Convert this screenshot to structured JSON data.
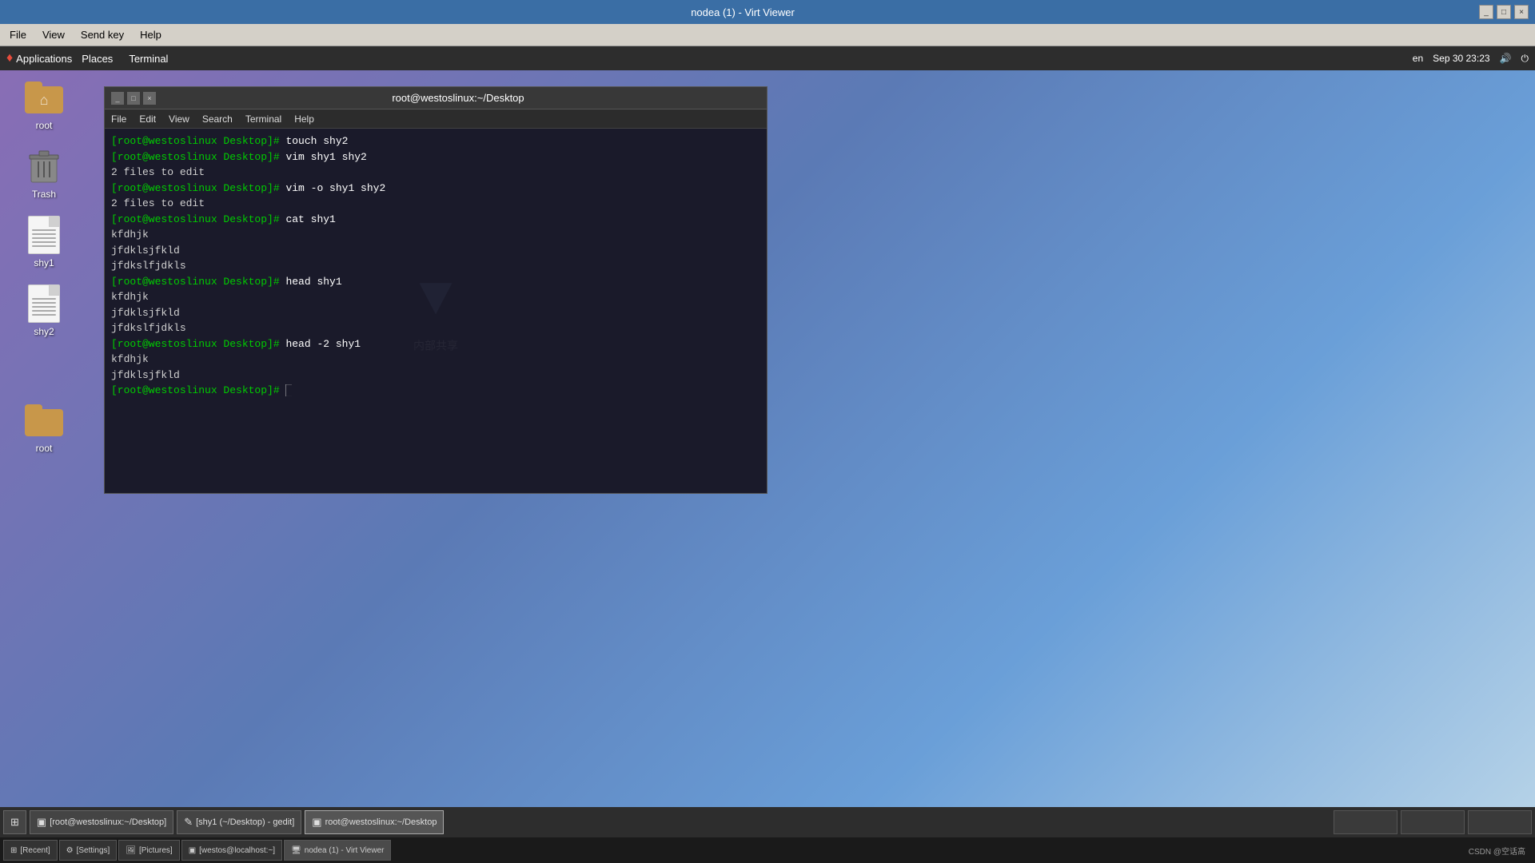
{
  "virtviewer": {
    "title": "nodea (1) - Virt Viewer",
    "menu": {
      "file": "File",
      "view": "View",
      "sendkey": "Send key",
      "help": "Help"
    },
    "titlebar_buttons": {
      "minimize": "_",
      "maximize": "□",
      "close": "×"
    }
  },
  "vm": {
    "panel": {
      "apps_label": "Applications",
      "places_label": "Places",
      "terminal_label": "Terminal",
      "locale": "en",
      "datetime": "Sep 30  23:23"
    },
    "desktop_icons": [
      {
        "id": "root-folder-top",
        "label": "root",
        "type": "folder-home"
      },
      {
        "id": "trash",
        "label": "Trash",
        "type": "trash"
      },
      {
        "id": "shy1-file",
        "label": "shy1",
        "type": "file"
      },
      {
        "id": "shy2-file",
        "label": "shy2",
        "type": "file"
      },
      {
        "id": "root-folder-bottom",
        "label": "root",
        "type": "folder"
      }
    ],
    "terminal": {
      "title": "root@westoslinux:~/Desktop",
      "menu": [
        "File",
        "Edit",
        "View",
        "Search",
        "Terminal",
        "Help"
      ],
      "lines": [
        {
          "type": "prompt",
          "text": "[root@westoslinux Desktop]# touch shy2"
        },
        {
          "type": "prompt",
          "text": "[root@westoslinux Desktop]# vim shy1 shy2"
        },
        {
          "type": "output",
          "text": "2 files to edit"
        },
        {
          "type": "prompt",
          "text": "[root@westoslinux Desktop]# vim -o shy1 shy2"
        },
        {
          "type": "output",
          "text": "2 files to edit"
        },
        {
          "type": "prompt",
          "text": "[root@westoslinux Desktop]# cat shy1"
        },
        {
          "type": "output",
          "text": "kfdhjk"
        },
        {
          "type": "output",
          "text": "jfdklsjfkld"
        },
        {
          "type": "output",
          "text": "jfdkslfjdkls"
        },
        {
          "type": "prompt",
          "text": "[root@westoslinux Desktop]# head shy1"
        },
        {
          "type": "output",
          "text": "kfdhjk"
        },
        {
          "type": "output",
          "text": "jfdklsjfkld"
        },
        {
          "type": "output",
          "text": "jfdkslfjdkls"
        },
        {
          "type": "prompt",
          "text": "[root@westoslinux Desktop]# head -2 shy1"
        },
        {
          "type": "output",
          "text": "kfdhjk"
        },
        {
          "type": "output",
          "text": "jfdklsjfkld"
        },
        {
          "type": "prompt-empty",
          "text": "[root@westoslinux Desktop]# "
        }
      ]
    },
    "taskbar": {
      "buttons": [
        {
          "id": "show-desktop",
          "icon": "⊞",
          "label": ""
        },
        {
          "id": "terminal-task",
          "icon": "▣",
          "label": "[root@westoslinux:~/Desktop]",
          "active": false
        },
        {
          "id": "gedit-task",
          "icon": "✎",
          "label": "[shy1 (~/Desktop) - gedit]",
          "active": false
        },
        {
          "id": "desktop-task",
          "icon": "▣",
          "label": "root@westoslinux:~/Desktop",
          "active": true
        }
      ],
      "empty1": "",
      "empty2": "",
      "empty3": ""
    }
  },
  "host_taskbar": {
    "buttons": [
      {
        "id": "recent",
        "icon": "⊞",
        "label": "[Recent]"
      },
      {
        "id": "settings",
        "icon": "⚙",
        "label": "[Settings]"
      },
      {
        "id": "pictures",
        "icon": "🖼",
        "label": "[Pictures]"
      },
      {
        "id": "westos",
        "icon": "▣",
        "label": "[westos@localhost:~]"
      },
      {
        "id": "nodea",
        "icon": "🖥",
        "label": "nodea (1) - Virt Viewer",
        "active": true
      }
    ],
    "right": "CSDN @空话高"
  }
}
